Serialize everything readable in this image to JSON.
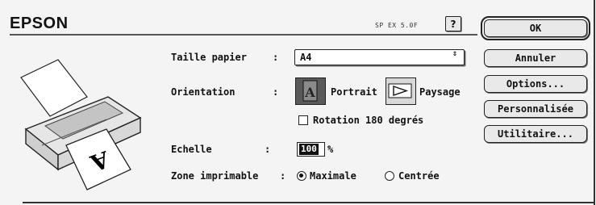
{
  "dialog": {
    "brand": "EPSON",
    "version": "SP EX 5.0F",
    "help_label": "?"
  },
  "paper_size": {
    "label": "Taille papier",
    "colon": ":",
    "value": "A4",
    "arrow": "⇕"
  },
  "orientation": {
    "label": "Orientation",
    "colon": ":",
    "options": [
      {
        "label": "Portrait",
        "selected": true
      },
      {
        "label": "Paysage",
        "selected": false
      }
    ]
  },
  "rotation": {
    "label": "Rotation 180 degrés",
    "checked": false
  },
  "scale": {
    "label": "Echelle",
    "colon": ":",
    "value": "100",
    "unit": "%"
  },
  "printable_area": {
    "label": "Zone imprimable",
    "colon": ":",
    "options": [
      {
        "label": "Maximale",
        "checked": true
      },
      {
        "label": "Centrée",
        "checked": false
      }
    ]
  },
  "buttons": {
    "ok": "OK",
    "cancel": "Annuler",
    "options": "Options...",
    "custom": "Personnalisée",
    "utility": "Utilitaire..."
  },
  "printer_preview": {
    "page_letter": "A"
  }
}
